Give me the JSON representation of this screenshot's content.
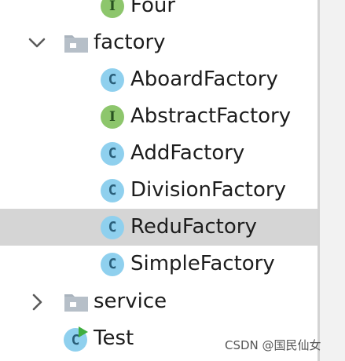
{
  "tree": {
    "partial_item": {
      "label": "Four",
      "icon": "interface-icon"
    },
    "factory_folder": {
      "label": "factory",
      "expanded": true,
      "icon": "folder-icon"
    },
    "factory_children": [
      {
        "label": "AboardFactory",
        "kind": "class",
        "glyph": "C"
      },
      {
        "label": "AbstractFactory",
        "kind": "interface",
        "glyph": "I"
      },
      {
        "label": "AddFactory",
        "kind": "class",
        "glyph": "C"
      },
      {
        "label": "DivisionFactory",
        "kind": "class",
        "glyph": "C"
      },
      {
        "label": "ReduFactory",
        "kind": "class",
        "glyph": "C",
        "selected": true
      },
      {
        "label": "SimpleFactory",
        "kind": "class",
        "glyph": "C"
      }
    ],
    "service_folder": {
      "label": "service",
      "expanded": false,
      "icon": "folder-icon"
    },
    "test_item": {
      "label": "Test",
      "icon": "runnable-class-icon",
      "glyph": "C"
    }
  },
  "watermark": "CSDN @国民仙女",
  "colors": {
    "class_badge": "#8fd0ee",
    "interface_badge": "#8dc66c",
    "selection": "#d5d5d5",
    "folder": "#a9b3bd",
    "run_marker": "#3fae3f"
  }
}
